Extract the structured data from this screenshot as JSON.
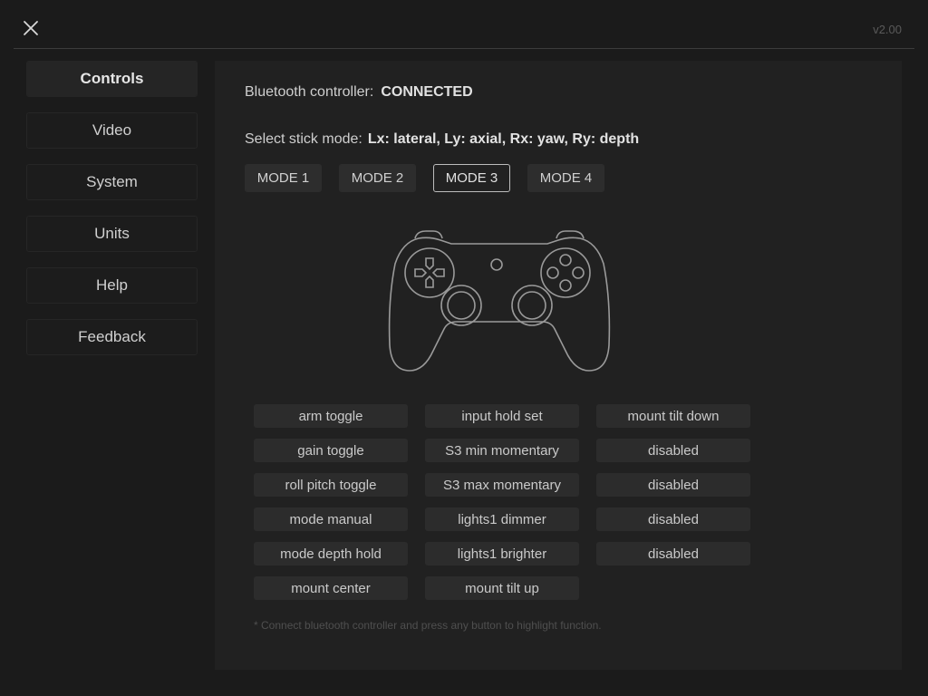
{
  "header": {
    "version": "v2.00",
    "close_icon": "close-icon"
  },
  "sidebar": {
    "items": [
      {
        "label": "Controls",
        "active": true
      },
      {
        "label": "Video",
        "active": false
      },
      {
        "label": "System",
        "active": false
      },
      {
        "label": "Units",
        "active": false
      },
      {
        "label": "Help",
        "active": false
      },
      {
        "label": "Feedback",
        "active": false
      }
    ]
  },
  "main": {
    "bluetooth_label": "Bluetooth controller:",
    "bluetooth_status": "CONNECTED",
    "stick_mode_label": "Select stick mode:",
    "stick_mode_desc": "Lx: lateral, Ly: axial, Rx: yaw, Ry: depth",
    "modes": [
      "MODE 1",
      "MODE 2",
      "MODE 3",
      "MODE 4"
    ],
    "selected_mode": "MODE 3",
    "gamepad_icon": "gamepad-icon",
    "functions": [
      [
        "arm toggle",
        "input hold set",
        "mount tilt down"
      ],
      [
        "gain toggle",
        "S3 min momentary",
        "disabled"
      ],
      [
        "roll pitch toggle",
        "S3 max momentary",
        "disabled"
      ],
      [
        "mode manual",
        "lights1 dimmer",
        "disabled"
      ],
      [
        "mode depth hold",
        "lights1 brighter",
        "disabled"
      ],
      [
        "mount center",
        "mount tilt up"
      ]
    ],
    "footnote": "* Connect bluetooth controller and press any button to highlight function."
  },
  "colors": {
    "background": "#1b1b1b",
    "panel": "#212121",
    "button": "#2c2c2c",
    "text": "#d2d2d2"
  }
}
